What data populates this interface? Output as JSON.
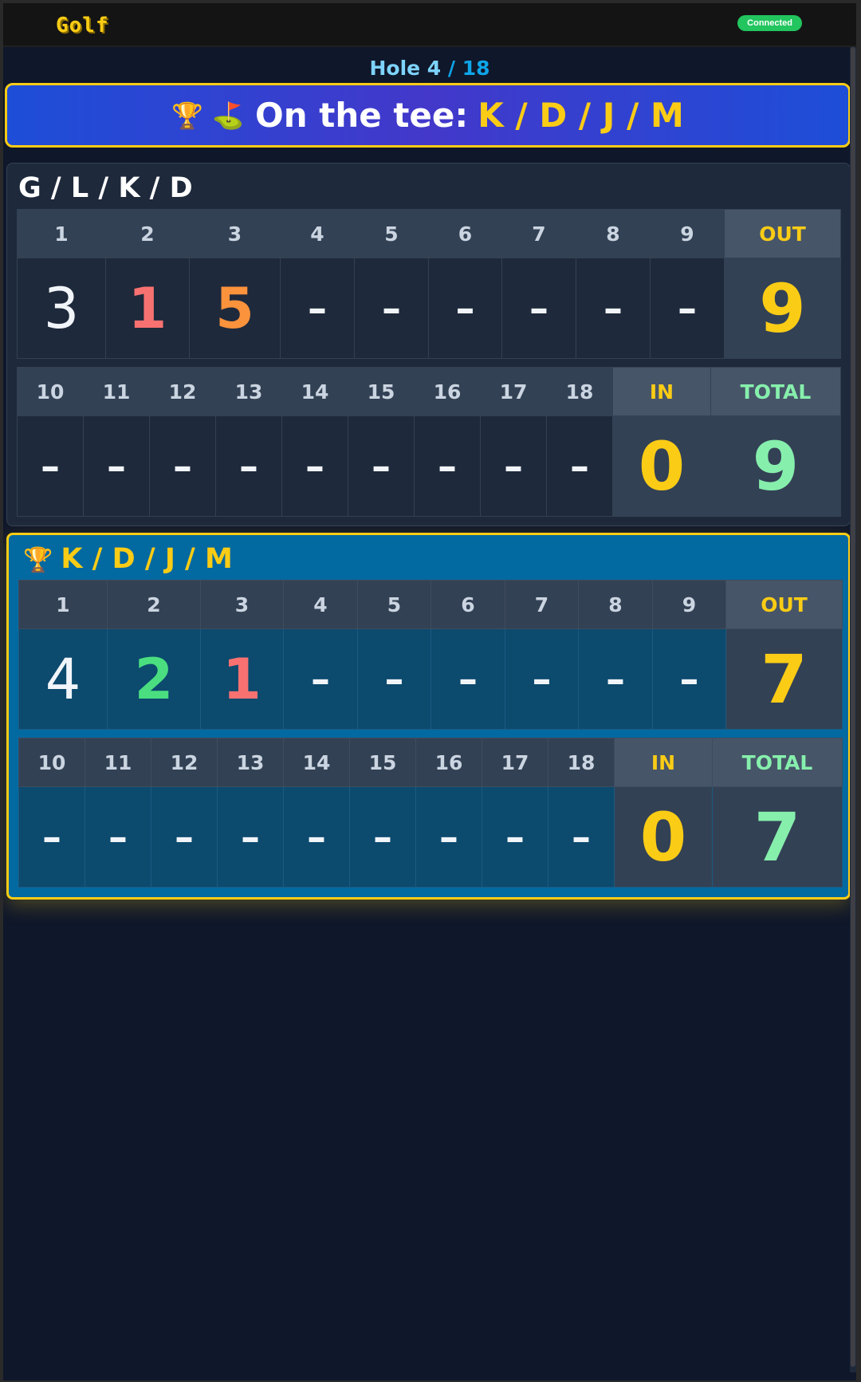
{
  "app": {
    "title": "Golf",
    "status": "Connected"
  },
  "hole": {
    "current": "Hole 4",
    "total": " / 18"
  },
  "tee": {
    "icons": "🏆 ⛳",
    "label": "On the tee:",
    "group": "K / D / J / M"
  },
  "colors": {
    "accent": "#facc15",
    "total": "#86efac",
    "tee_bg": "#1d4ed8",
    "active_card": "#0369a1"
  },
  "scorecards": [
    {
      "name": "G / L / K / D",
      "active": false,
      "front_holes": [
        "1",
        "2",
        "3",
        "4",
        "5",
        "6",
        "7",
        "8",
        "9"
      ],
      "front_scores": [
        "3",
        "1",
        "5",
        "–",
        "–",
        "–",
        "–",
        "–",
        "–"
      ],
      "out_label": "OUT",
      "out": "9",
      "back_holes": [
        "10",
        "11",
        "12",
        "13",
        "14",
        "15",
        "16",
        "17",
        "18"
      ],
      "back_scores": [
        "–",
        "–",
        "–",
        "–",
        "–",
        "–",
        "–",
        "–",
        "–"
      ],
      "in_label": "IN",
      "in": "0",
      "total_label": "TOTAL",
      "total": "9"
    },
    {
      "name": "K / D / J / M",
      "active": true,
      "trophy_icon": "🏆",
      "front_holes": [
        "1",
        "2",
        "3",
        "4",
        "5",
        "6",
        "7",
        "8",
        "9"
      ],
      "front_scores": [
        "4",
        "2",
        "1",
        "–",
        "–",
        "–",
        "–",
        "–",
        "–"
      ],
      "out_label": "OUT",
      "out": "7",
      "back_holes": [
        "10",
        "11",
        "12",
        "13",
        "14",
        "15",
        "16",
        "17",
        "18"
      ],
      "back_scores": [
        "–",
        "–",
        "–",
        "–",
        "–",
        "–",
        "–",
        "–",
        "–"
      ],
      "in_label": "IN",
      "in": "0",
      "total_label": "TOTAL",
      "total": "7"
    }
  ]
}
